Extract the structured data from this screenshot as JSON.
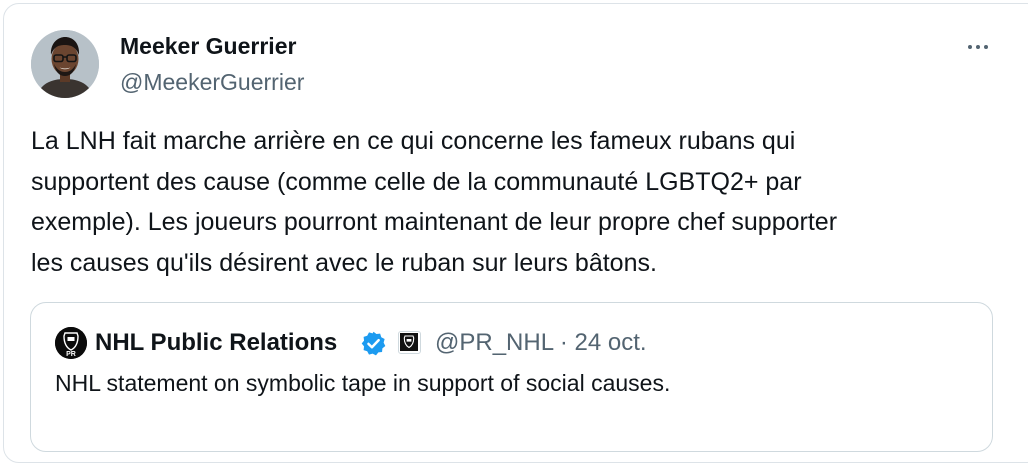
{
  "tweet": {
    "author_name": "Meeker Guerrier",
    "author_handle": "@MeekerGuerrier",
    "more_icon": "more-horizontal-icon",
    "text_lines": [
      "La LNH fait marche arrière en ce qui concerne les fameux rubans qui",
      "supportent des cause (comme celle de la communauté LGBTQ2+ par",
      "exemple). Les joueurs pourront maintenant de leur propre chef supporter",
      "les causes qu'ils désirent avec le ruban sur leurs bâtons."
    ]
  },
  "quoted_tweet": {
    "author_name": "NHL Public Relations",
    "verified_icon": "verified-badge-icon",
    "affiliate_icon": "nhl-affiliate-badge-icon",
    "handle": "@PR_NHL",
    "separator": "·",
    "date": "24 oct.",
    "text": "NHL statement on symbolic tape in support of social causes.",
    "avatar_label": "PR"
  },
  "colors": {
    "text": "#0f1419",
    "secondary": "#536471",
    "border": "#cfd9de",
    "verified": "#1d9bf0"
  }
}
